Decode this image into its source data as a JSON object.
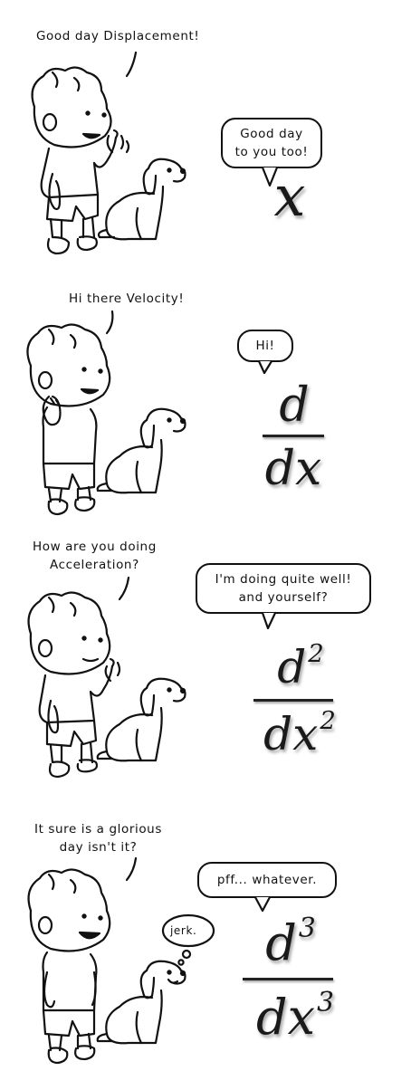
{
  "panels": [
    {
      "speaker_line1": "Good day Displacement!",
      "speaker_line2": "",
      "reply_line1": "Good day",
      "reply_line2": "to you too!",
      "math": {
        "numerator": "",
        "denominator": "",
        "power": "",
        "single": "x"
      }
    },
    {
      "speaker_line1": "Hi there Velocity!",
      "speaker_line2": "",
      "reply_line1": "Hi!",
      "reply_line2": "",
      "math": {
        "numerator": "d",
        "denominator": "dx",
        "power": ""
      }
    },
    {
      "speaker_line1": "How are you doing",
      "speaker_line2": "Acceleration?",
      "reply_line1": "I'm doing quite well!",
      "reply_line2": "and yourself?",
      "math": {
        "numerator": "d",
        "denominator": "dx",
        "power": "2"
      }
    },
    {
      "speaker_line1": "It sure is a glorious",
      "speaker_line2": "day isn't it?",
      "reply_line1": "pff... whatever.",
      "reply_line2": "",
      "thought": "jerk.",
      "math": {
        "numerator": "d",
        "denominator": "dx",
        "power": "3"
      }
    }
  ]
}
